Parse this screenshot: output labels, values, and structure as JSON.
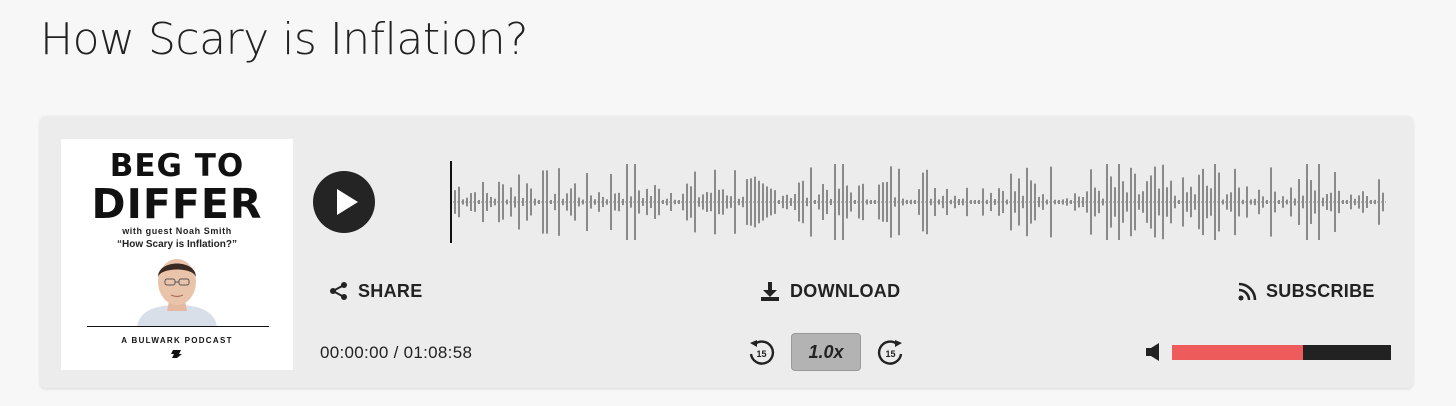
{
  "page": {
    "title": "How Scary is Inflation?"
  },
  "cover": {
    "line1": "BEG TO",
    "line2": "DIFFER",
    "guest": "with guest Noah Smith",
    "episode": "“How Scary is Inflation?”",
    "brand": "A BULWARK PODCAST"
  },
  "player": {
    "play_icon": "play-icon",
    "actions": {
      "share": {
        "label": "SHARE",
        "icon": "share-icon"
      },
      "download": {
        "label": "DOWNLOAD",
        "icon": "download-icon"
      },
      "subscribe": {
        "label": "SUBSCRIBE",
        "icon": "rss-icon"
      }
    },
    "time": "00:00:00 / 01:08:58",
    "speed": "1.0x",
    "skip_back": "15",
    "skip_forward": "15",
    "volume": {
      "level": 0.6,
      "fill_color": "#ee5b5b",
      "track_color": "#222222"
    }
  }
}
